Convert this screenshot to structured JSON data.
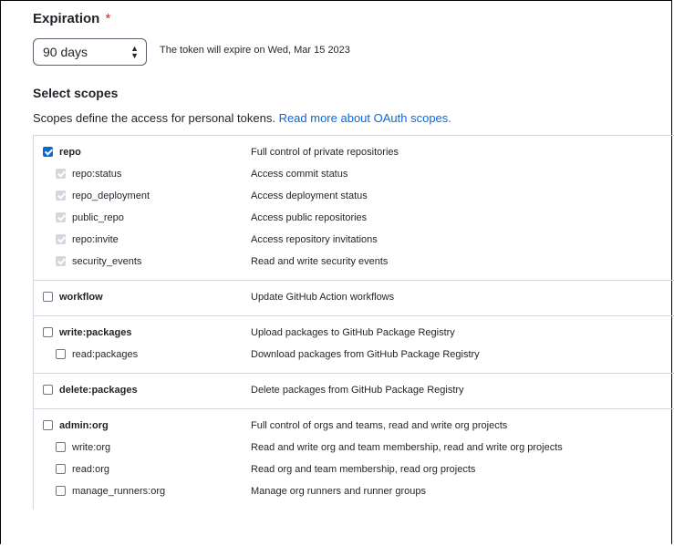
{
  "expiration": {
    "label": "Expiration",
    "required_mark": "*",
    "selected": "90 days",
    "note": "The token will expire on Wed, Mar 15 2023"
  },
  "scopes": {
    "title": "Select scopes",
    "desc": "Scopes define the access for personal tokens.",
    "link": "Read more about OAuth scopes."
  },
  "groups": [
    {
      "parent": {
        "name": "repo",
        "desc": "Full control of private repositories",
        "checked": true
      },
      "children": [
        {
          "name": "repo:status",
          "desc": "Access commit status",
          "checked": true
        },
        {
          "name": "repo_deployment",
          "desc": "Access deployment status",
          "checked": true
        },
        {
          "name": "public_repo",
          "desc": "Access public repositories",
          "checked": true
        },
        {
          "name": "repo:invite",
          "desc": "Access repository invitations",
          "checked": true
        },
        {
          "name": "security_events",
          "desc": "Read and write security events",
          "checked": true
        }
      ]
    },
    {
      "parent": {
        "name": "workflow",
        "desc": "Update GitHub Action workflows",
        "checked": false
      },
      "children": []
    },
    {
      "parent": {
        "name": "write:packages",
        "desc": "Upload packages to GitHub Package Registry",
        "checked": false
      },
      "children": [
        {
          "name": "read:packages",
          "desc": "Download packages from GitHub Package Registry",
          "checked": false
        }
      ]
    },
    {
      "parent": {
        "name": "delete:packages",
        "desc": "Delete packages from GitHub Package Registry",
        "checked": false
      },
      "children": []
    },
    {
      "parent": {
        "name": "admin:org",
        "desc": "Full control of orgs and teams, read and write org projects",
        "checked": false
      },
      "children": [
        {
          "name": "write:org",
          "desc": "Read and write org and team membership, read and write org projects",
          "checked": false
        },
        {
          "name": "read:org",
          "desc": "Read org and team membership, read org projects",
          "checked": false
        },
        {
          "name": "manage_runners:org",
          "desc": "Manage org runners and runner groups",
          "checked": false
        }
      ]
    }
  ],
  "colors": {
    "accent": "#0969da",
    "required": "#cf222e",
    "border": "#d0d7de"
  }
}
